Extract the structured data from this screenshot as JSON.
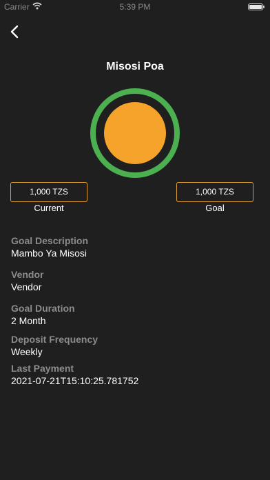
{
  "status_bar": {
    "carrier": "Carrier",
    "time": "5:39 PM"
  },
  "header": {
    "back_icon": "chevron-left-icon",
    "title": "Misosi Poa"
  },
  "progress": {
    "ring_color": "#4caf50",
    "fill_color": "#f5a32a",
    "fraction": 1.0
  },
  "amounts": {
    "current_value": "1,000 TZS",
    "current_label": "Current",
    "goal_value": "1,000 TZS",
    "goal_label": "Goal",
    "border_color": "#e0a030"
  },
  "details": [
    {
      "label": "Goal Description",
      "value": "Mambo Ya Misosi"
    },
    {
      "label": "Vendor",
      "value": "Vendor"
    },
    {
      "label": "Goal Duration",
      "value": "2 Month"
    },
    {
      "label": "Deposit Frequency",
      "value": "Weekly"
    },
    {
      "label": "Last Payment",
      "value": "2021-07-21T15:10:25.781752"
    }
  ]
}
